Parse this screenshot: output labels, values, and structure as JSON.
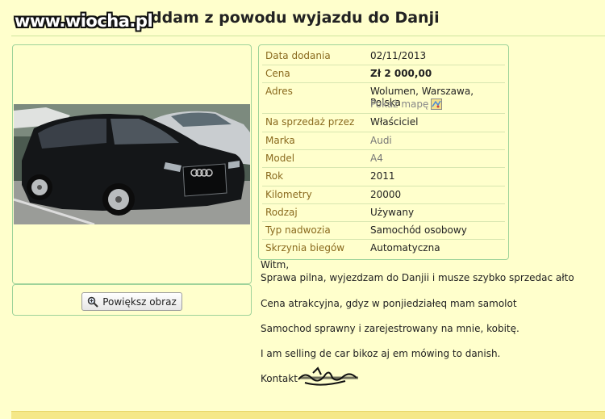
{
  "header": {
    "title": "Audi A4 Avant oddam z powodu wyjazdu do Danji",
    "watermark": "www.wiocha.pl"
  },
  "image_panel": {
    "photo_alt": "black Audi A4 Avant",
    "enlarge_label": "Powiększ obraz"
  },
  "details": [
    {
      "label": "Data dodania",
      "value": "02/11/2013"
    },
    {
      "label": "Cena",
      "value": "Zł  2 000,00"
    },
    {
      "label": "Adres",
      "value": "Wolumen, Warszawa, Polska",
      "extra": "Pokaż mapę"
    },
    {
      "label": "Na sprzedaż przez",
      "value": "Właściciel"
    },
    {
      "label": "Marka",
      "value": "Audi"
    },
    {
      "label": "Model",
      "value": "A4"
    },
    {
      "label": "Rok",
      "value": "2011"
    },
    {
      "label": "Kilometry",
      "value": "20000"
    },
    {
      "label": "Rodzaj",
      "value": "Używany"
    },
    {
      "label": "Typ nadwozia",
      "value": "Samochód osobowy"
    },
    {
      "label": "Skrzynia biegów",
      "value": "Automatyczna"
    }
  ],
  "description": {
    "greeting": "Witm,",
    "line1": "Sprawa pilna, wyjezdzam do Danjii i musze szybko sprzedac ałto",
    "line2": "Cena atrakcyjna, gdyz w ponjiedziałeq mam samolot",
    "line3": "Samochod sprawny i zarejestrowany na mnie, kobitę.",
    "line4": "I am selling de car bikoz aj em mówing to danish.",
    "contact_label": "Kontakt"
  }
}
